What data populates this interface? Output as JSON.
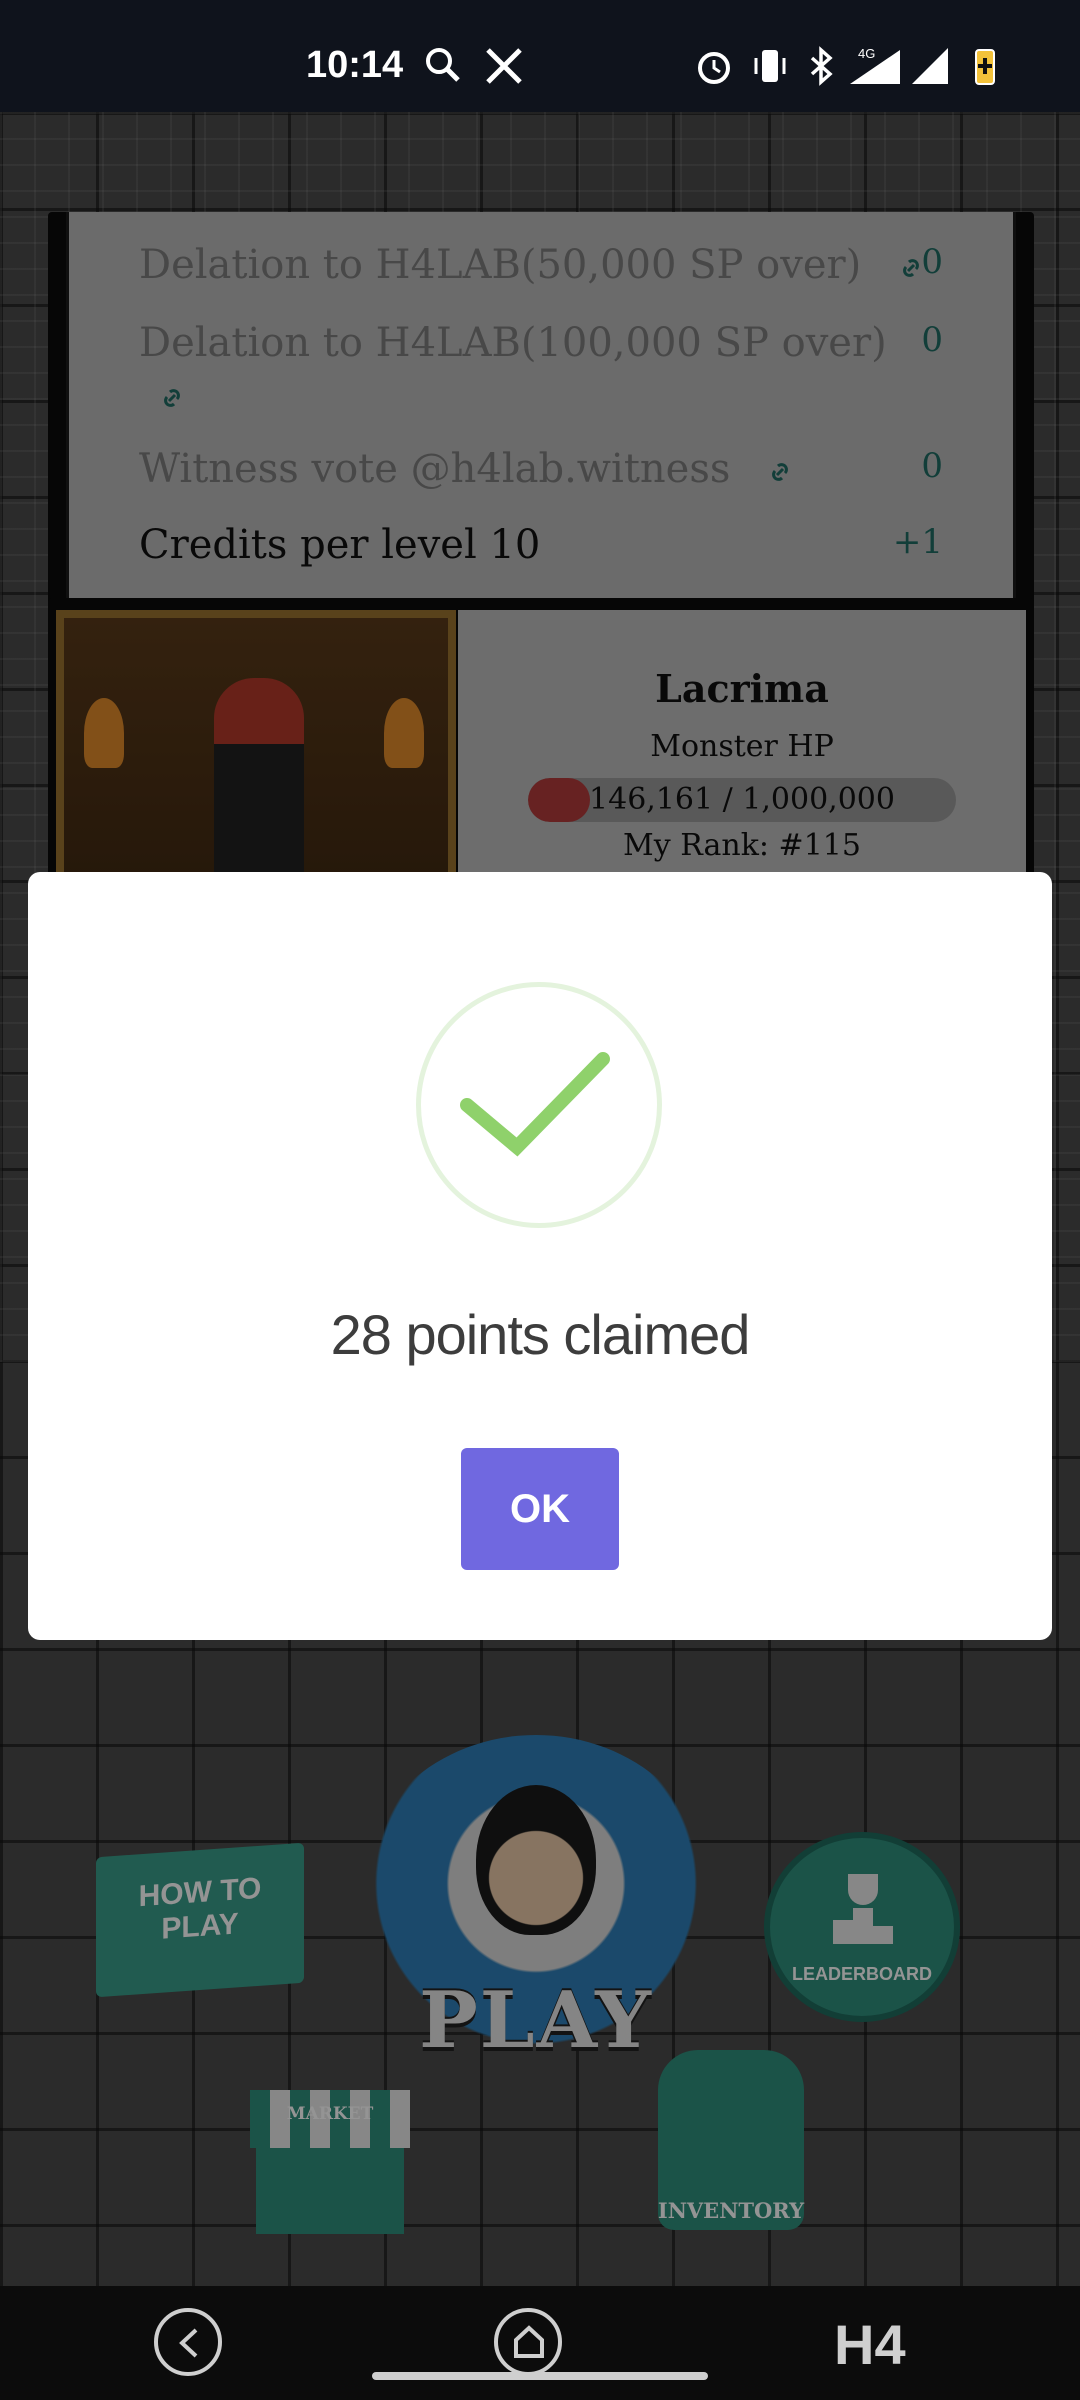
{
  "status_bar": {
    "time": "10:14",
    "network": "4G",
    "icons": [
      "news-app-icon",
      "x-icon",
      "alarm-icon",
      "vibrate-icon",
      "bluetooth-icon",
      "signal-icon",
      "wifi-signal-icon",
      "battery-charging-icon"
    ]
  },
  "credits_panel": {
    "rows": [
      {
        "label": "Delation to H4LAB(50,000 SP over)",
        "value": "0",
        "has_link": true
      },
      {
        "label": "Delation to H4LAB(100,000 SP over)",
        "value": "0",
        "has_link": true
      },
      {
        "label": "Witness vote @h4lab.witness",
        "value": "0",
        "has_link": true
      },
      {
        "label": "Credits per level 10",
        "value": "+1",
        "has_link": false
      }
    ]
  },
  "monster": {
    "name": "Lacrima",
    "hp_label": "Monster HP",
    "hp_text": "146,161 / 1,000,000",
    "hp_fraction": 0.146,
    "rank_text": "My Rank: #115"
  },
  "modal": {
    "message": "28 points claimed",
    "ok_label": "OK",
    "check_color": "#8fd16b"
  },
  "game_buttons": {
    "how_to_play": "HOW TO PLAY",
    "play": "PLAY",
    "leaderboard": "LEADERBOARD",
    "market": "MARKET",
    "inventory": "INVENTORY"
  },
  "nav": {
    "logo": "H4"
  }
}
